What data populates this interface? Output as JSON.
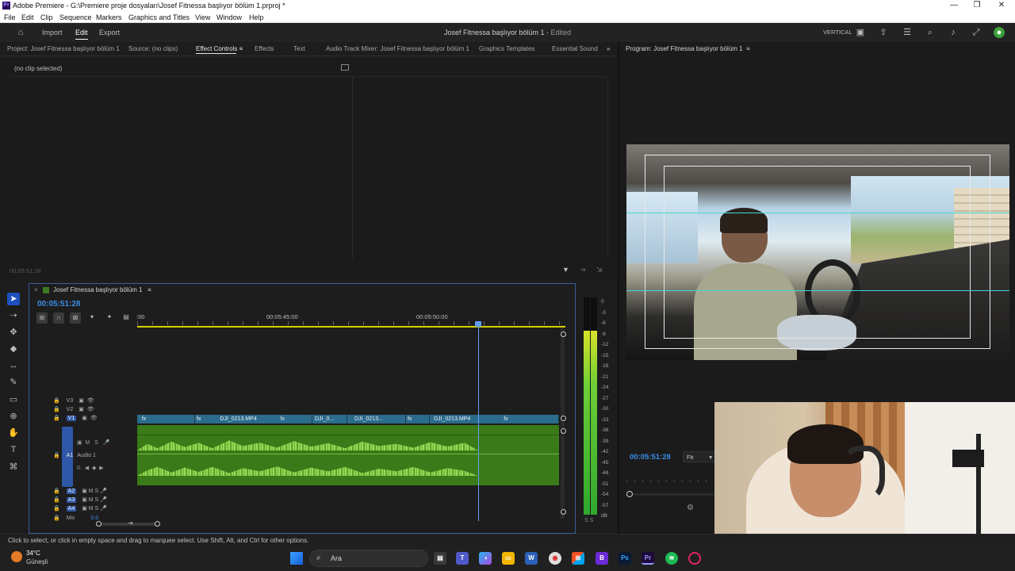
{
  "window": {
    "title": "Adobe Premiere - G:\\Premiere proje dosyaları\\Josef Fitnessa başlıyor bölüm 1.prproj *"
  },
  "menu": [
    "File",
    "Edit",
    "Clip",
    "Sequence",
    "Markers",
    "Graphics and Titles",
    "View",
    "Window",
    "Help"
  ],
  "header": {
    "nav": [
      "Import",
      "Edit",
      "Export"
    ],
    "active_nav": "Edit",
    "project_title": "Josef Fitnessa başlıyor bölüm 1",
    "edited": " - Edited",
    "vertical_label": "VERTICAL"
  },
  "panel_tabs": [
    "Project: Josef Fitnessa başlıyor bölüm 1",
    "Source: (no clips)",
    "Effect Controls",
    "Effects",
    "Text",
    "Audio Track Mixer: Josef Fitnessa başlıyor bölüm 1",
    "Graphics Templates",
    "Essential Sound"
  ],
  "active_tab": "Effect Controls",
  "effect_controls": {
    "empty_text": "(no clip selected)",
    "timecode": "00:05:51:28"
  },
  "program": {
    "title": "Program: Josef Fitnessa başlıyor bölüm 1",
    "timecode": "00:05:51:28",
    "zoom": "Fit"
  },
  "timeline": {
    "sequence_name": "Josef Fitnessa başlıyor bölüm 1",
    "timecode": "00:05:51:28",
    "ruler": [
      ":00",
      "00:05:45:00",
      "00:05:50:00"
    ],
    "video_tracks": [
      "V3",
      "V2",
      "V1"
    ],
    "audio_tracks": [
      "A1",
      "A2",
      "A3",
      "A4"
    ],
    "audio1_name": "Audio 1",
    "mix_label": "Mix",
    "mix_value": "0.0",
    "clips": [
      {
        "label": "DJI_0213.MP4"
      },
      {
        "label": "DJI_0..."
      },
      {
        "label": "DJI_0213..."
      },
      {
        "label": "DJI_0213.MP4"
      }
    ]
  },
  "meter": {
    "scale": [
      "0",
      "-3",
      "-6",
      "-9",
      "-12",
      "-15",
      "-18",
      "-21",
      "-24",
      "-27",
      "-30",
      "-33",
      "-36",
      "-39",
      "-42",
      "-45",
      "-48",
      "-51",
      "-54",
      "-57",
      "dB"
    ],
    "footer": "S S"
  },
  "status_bar": "Click to select, or click in empty space and drag to marquee select. Use Shift, Alt, and Ctrl for other options.",
  "taskbar": {
    "temperature": "34°C",
    "weather": "Güneşli",
    "search": "Ara"
  },
  "colors": {
    "accent": "#3b8ee8",
    "clip_video": "#2b6b8b",
    "clip_audio": "#3b7a18",
    "selection": "#1f4fbf"
  }
}
